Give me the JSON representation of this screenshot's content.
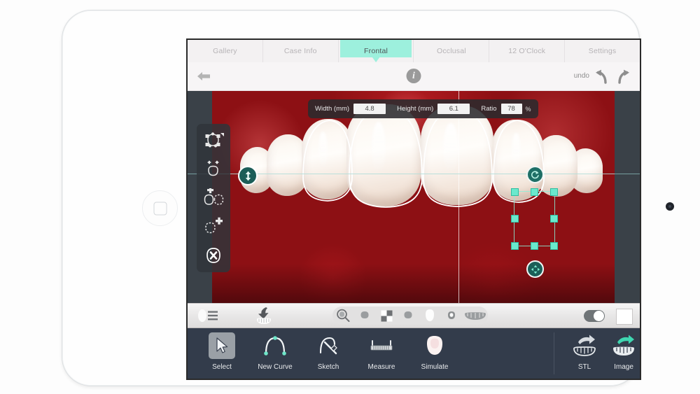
{
  "app": {
    "device": "ipad",
    "accent_color": "#9df0dd",
    "handle_color": "#6ae9cd",
    "toolbar_bg": "#333c4b"
  },
  "tabs": [
    {
      "label": "Gallery",
      "active": false
    },
    {
      "label": "Case Info",
      "active": false
    },
    {
      "label": "Frontal",
      "active": true
    },
    {
      "label": "Occlusal",
      "active": false
    },
    {
      "label": "12 O'Clock",
      "active": false
    },
    {
      "label": "Settings",
      "active": false
    }
  ],
  "navbar": {
    "back_icon": "back-arrow-icon",
    "info_icon": "info-icon",
    "info_glyph": "i",
    "undo_label": "undo",
    "undo_icon": "undo-arrow-icon",
    "redo_icon": "redo-arrow-icon"
  },
  "measurements": {
    "width": {
      "label": "Width (mm)",
      "value": "4.8"
    },
    "height": {
      "label": "Height (mm)",
      "value": "6.1"
    },
    "ratio": {
      "label": "Ratio",
      "value": "78",
      "unit": "%"
    }
  },
  "left_rail": [
    {
      "name": "edit-nodes-tool",
      "icon": "shape-nodes-icon"
    },
    {
      "name": "move-shape-tool",
      "icon": "move-shape-icon"
    },
    {
      "name": "duplicate-shape-tool",
      "icon": "duplicate-shape-icon"
    },
    {
      "name": "add-shape-tool",
      "icon": "add-shape-icon"
    },
    {
      "name": "delete-shape-tool",
      "icon": "delete-shape-icon"
    }
  ],
  "canvas": {
    "rotate_handle_icon": "rotate-icon",
    "move_handle_icon": "move-cross-icon",
    "vertical_adjust_icon": "up-down-arrow-icon",
    "handle_count": 8
  },
  "icon_strip": {
    "left": [
      {
        "name": "layers-list-icon",
        "icon": "list-lines-icon"
      },
      {
        "name": "tooth-import-icon",
        "icon": "tooth-down-arrow-icon"
      }
    ],
    "pill": [
      {
        "name": "zoom-tool-icon",
        "icon": "magnifier-icon"
      },
      {
        "name": "tooth-shade-1-icon",
        "icon": "tooth-dome-icon"
      },
      {
        "name": "checker-overlay-icon",
        "icon": "checkerboard-icon"
      },
      {
        "name": "tooth-shade-2-icon",
        "icon": "tooth-dome-icon"
      },
      {
        "name": "tooth-shape-icon",
        "icon": "tooth-white-icon"
      },
      {
        "name": "single-tooth-icon",
        "icon": "small-tooth-icon"
      },
      {
        "name": "full-arch-icon",
        "icon": "teeth-arch-icon"
      }
    ],
    "toggle": {
      "name": "overlay-toggle",
      "state": "on"
    },
    "swatch": {
      "name": "color-swatch",
      "color": "#ffffff"
    }
  },
  "bottom_tools": [
    {
      "label": "Select",
      "icon": "cursor-arrow-icon",
      "selected": true
    },
    {
      "label": "New Curve",
      "icon": "bezier-curve-icon",
      "selected": false
    },
    {
      "label": "Sketch",
      "icon": "pencil-sketch-icon",
      "selected": false
    },
    {
      "label": "Measure",
      "icon": "ruler-icon",
      "selected": false
    },
    {
      "label": "Simulate",
      "icon": "tooth-simulate-icon",
      "selected": false
    }
  ],
  "export_tools": [
    {
      "label": "STL",
      "icon": "export-stl-icon",
      "arrow_color": "#d7dbe0"
    },
    {
      "label": "Image",
      "icon": "export-image-icon",
      "arrow_color": "#3fd6b0"
    }
  ]
}
